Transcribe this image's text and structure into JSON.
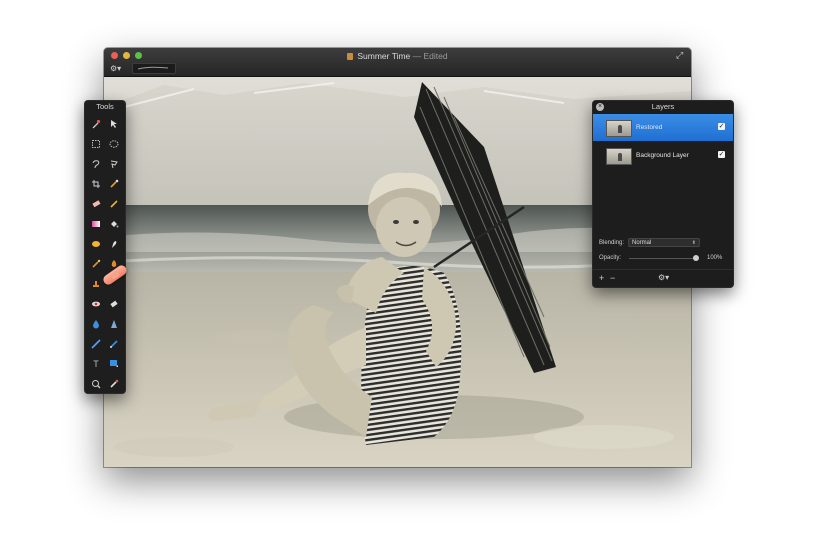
{
  "window": {
    "title": "Summer Time",
    "title_suffix": "— Edited",
    "toolbar": {
      "gear_menu_icon": "gear-icon",
      "brush_preview_icon": "brush-stroke-icon",
      "fullscreen_icon": "fullscreen-arrows-icon"
    }
  },
  "tools_panel": {
    "title": "Tools",
    "tools": [
      "magic-wand-icon",
      "move-arrow-icon",
      "rect-select-icon",
      "ellipse-select-icon",
      "lasso-icon",
      "polygon-lasso-icon",
      "crop-icon",
      "eyedropper-icon",
      "eraser-icon",
      "pencil-icon",
      "gradient-icon",
      "paint-bucket-icon",
      "sponge-icon",
      "smudge-icon",
      "brush-icon",
      "burn-icon",
      "clone-stamp-icon",
      "heal-icon",
      "red-eye-icon",
      "eraser-alt-icon",
      "blur-drop-icon",
      "sharpen-icon",
      "line-icon",
      "pen-icon",
      "text-icon",
      "shape-icon",
      "zoom-icon",
      "color-brush-icon"
    ],
    "text_tool_glyph": "T",
    "accent_color": "#f27d63"
  },
  "layers_panel": {
    "title": "Layers",
    "layers": [
      {
        "name": "Restored",
        "visible": true,
        "selected": true
      },
      {
        "name": "Background Layer",
        "visible": true,
        "selected": false
      }
    ],
    "blending_label": "Blending:",
    "blending_value": "Normal",
    "opacity_label": "Opacity:",
    "opacity_value": "100%",
    "opacity_fraction": 1.0,
    "add_label": "+",
    "remove_label": "−",
    "settings_icon": "gear-icon",
    "selection_color": "#2a7fe0"
  }
}
